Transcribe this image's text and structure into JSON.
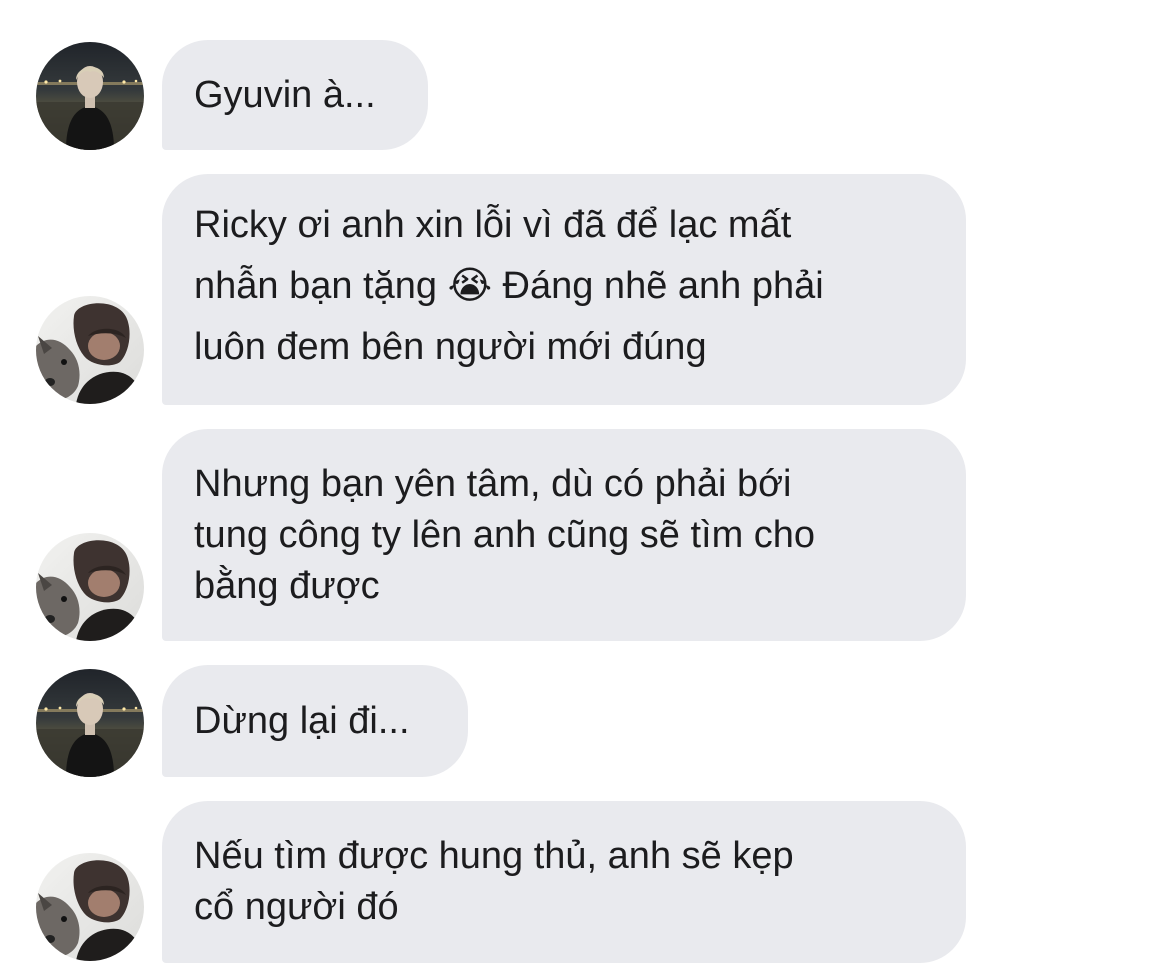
{
  "chat": {
    "messages": [
      {
        "text": "Gyuvin à...",
        "avatar": "night-beach-avatar"
      },
      {
        "text": "Ricky ơi anh xin lỗi vì đã để lạc mất\nnhẫn bạn tặng 😭  Đáng nhẽ anh phải\nluôn đem bên người mới đúng",
        "avatar": "dog-avatar"
      },
      {
        "text": "Nhưng bạn yên tâm, dù có phải bới\ntung công ty lên anh cũng sẽ tìm cho\nbằng được",
        "avatar": "dog-avatar"
      },
      {
        "text": "Dừng lại đi...",
        "avatar": "night-beach-avatar"
      },
      {
        "text": "Nếu tìm được hung thủ, anh sẽ kẹp\ncổ người đó",
        "avatar": "dog-avatar"
      }
    ]
  },
  "colors": {
    "bubble": "#e9eaee",
    "text": "#1c1c1e"
  }
}
